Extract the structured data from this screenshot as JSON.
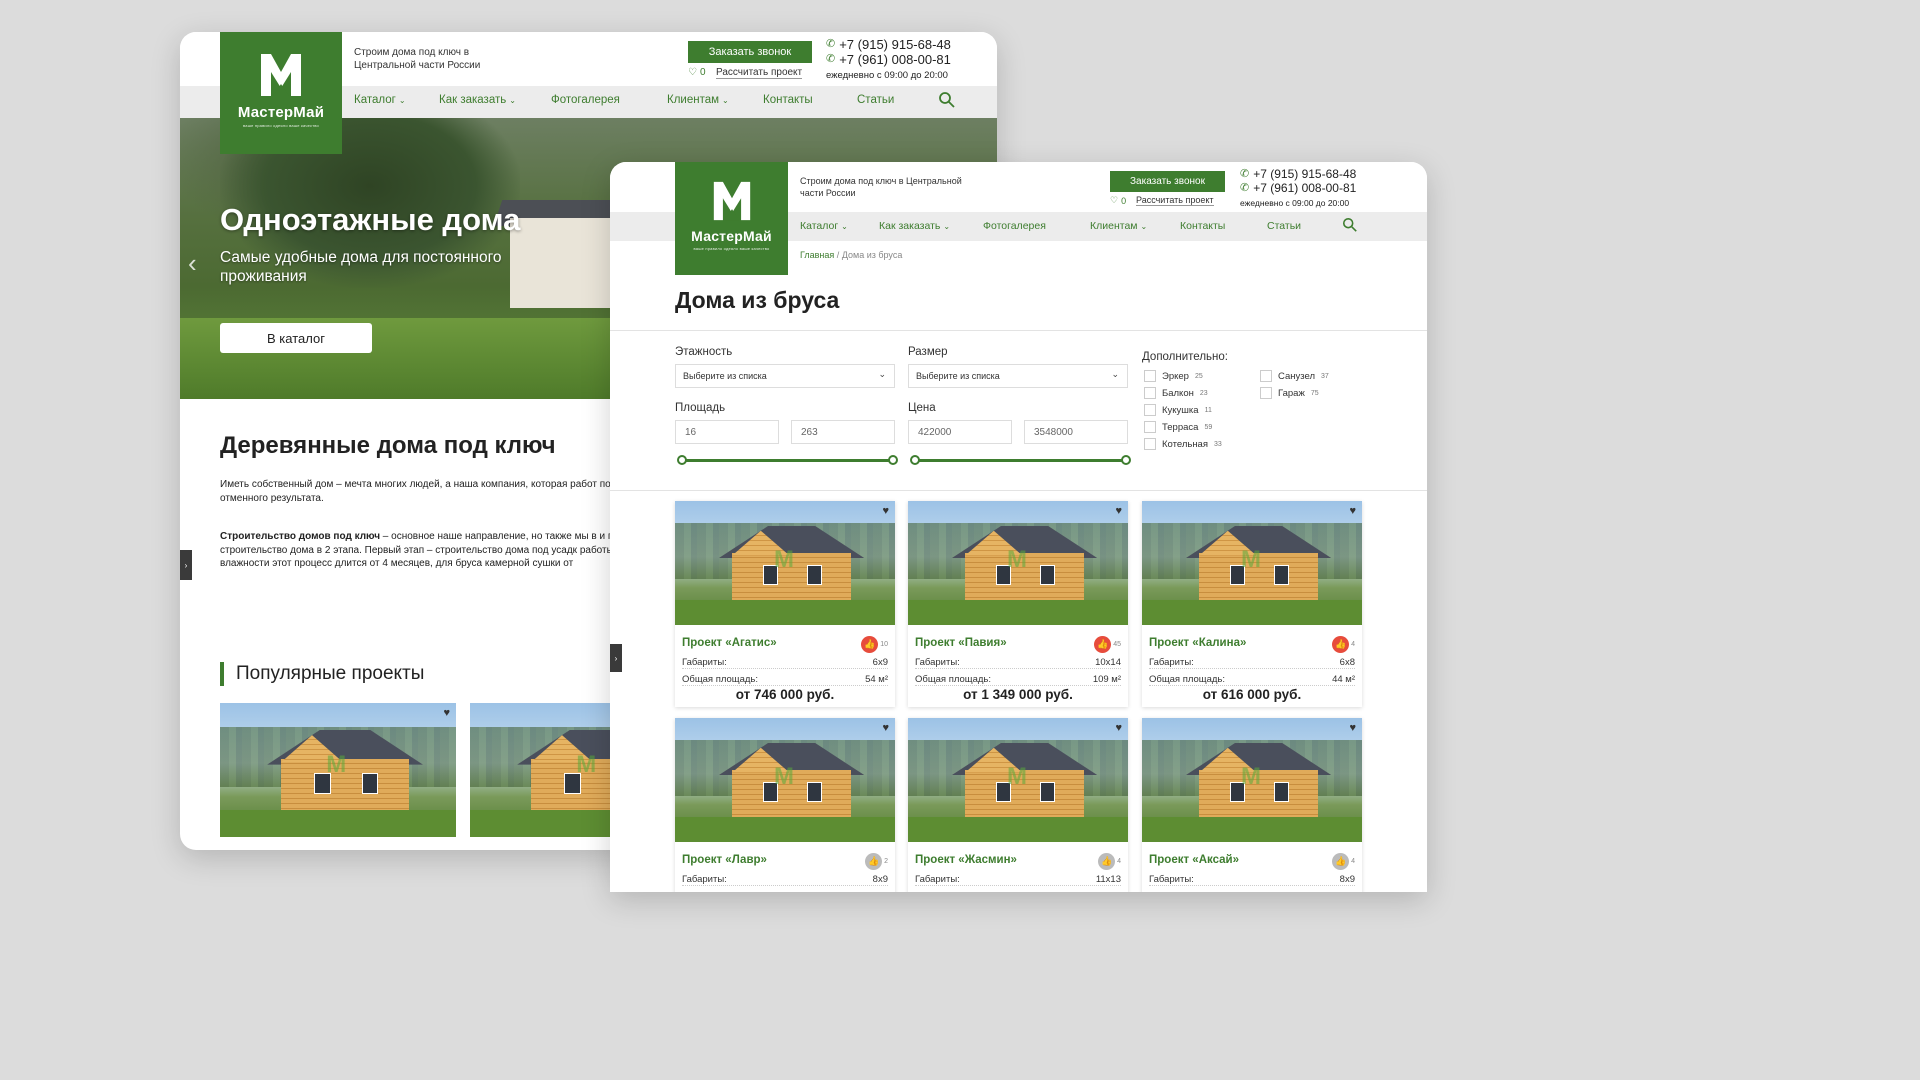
{
  "colors": {
    "brand": "#3e7d2f",
    "like_active": "#e74c3c",
    "like_inactive": "#999999"
  },
  "header": {
    "brand_name": "МастерМай",
    "slogan": "ваше правило одеяло вашe качество",
    "tagline": "Строим дома под ключ в Центральной части России",
    "cta": "Заказать звонок",
    "fav_count": "0",
    "calc_link": "Рассчитать проект",
    "phone1": "+7 (915) 915-68-48",
    "phone2": "+7 (961) 008-00-81",
    "hours": "ежедневно с 09:00 до 20:00",
    "nav": [
      "Каталог",
      "Как заказать",
      "Фотогалерея",
      "Клиентам",
      "Контакты",
      "Статьи"
    ]
  },
  "back_page": {
    "hero_title": "Одноэтажные дома",
    "hero_subtitle": "Самые удобные дома для постоянного проживания",
    "hero_button": "В каталог",
    "section_title": "Деревянные дома под ключ",
    "para1": "Иметь собственный дом – мечта многих людей, а наша компания, которая работ построить дом из дерева для сезонного или постоянного проживания. Использу отменного результата.",
    "para2_bold": "Строительство домов под ключ",
    "para2": " – основное наше направление, но также мы в и пр.). Выполняем весь комплекс работ – от разработки проекта до отделки. Обр строительство дома в 2 этапа. Первый этап – строительство дома под усадк работы. После постройки дома под усадку перед отделкой необходимо дож влажности этот процесс длится от 4 месяцев, для бруса камерной сушки от",
    "popular_title": "Популярные проекты"
  },
  "front_page": {
    "breadcrumb_home": "Главная",
    "breadcrumb_sep": "/",
    "breadcrumb_current": "Дома из бруса",
    "title": "Дома из бруса",
    "filters": {
      "floors_label": "Этажность",
      "floors_value": "Выберите из списка",
      "size_label": "Размер",
      "size_value": "Выберите из списка",
      "area_label": "Площадь",
      "area_min": "16",
      "area_max": "263",
      "price_label": "Цена",
      "price_min": "422000",
      "price_max": "3548000",
      "extra_label": "Дополнительно:",
      "extras": [
        {
          "label": "Эркер",
          "count": "25"
        },
        {
          "label": "Балкон",
          "count": "23"
        },
        {
          "label": "Кукушка",
          "count": "11"
        },
        {
          "label": "Терраса",
          "count": "59"
        },
        {
          "label": "Котельная",
          "count": "33"
        },
        {
          "label": "Санузел",
          "count": "37"
        },
        {
          "label": "Гараж",
          "count": "75"
        }
      ]
    },
    "dims_label": "Габариты:",
    "area_label": "Общая площадь:",
    "cards": [
      {
        "name": "Проект «Агатис»",
        "likes": "10",
        "dims": "6x9",
        "area": "54 м²",
        "price": "от 746 000 руб.",
        "liked": true
      },
      {
        "name": "Проект «Павия»",
        "likes": "45",
        "dims": "10x14",
        "area": "109 м²",
        "price": "от 1 349 000 руб.",
        "liked": true
      },
      {
        "name": "Проект «Калина»",
        "likes": "4",
        "dims": "6x8",
        "area": "44 м²",
        "price": "от 616 000 руб.",
        "liked": true
      },
      {
        "name": "Проект «Лавр»",
        "likes": "2",
        "dims": "8x9",
        "liked": false
      },
      {
        "name": "Проект «Жасмин»",
        "likes": "4",
        "dims": "11x13",
        "liked": false
      },
      {
        "name": "Проект «Аксай»",
        "likes": "4",
        "dims": "8x9",
        "liked": false
      }
    ]
  }
}
